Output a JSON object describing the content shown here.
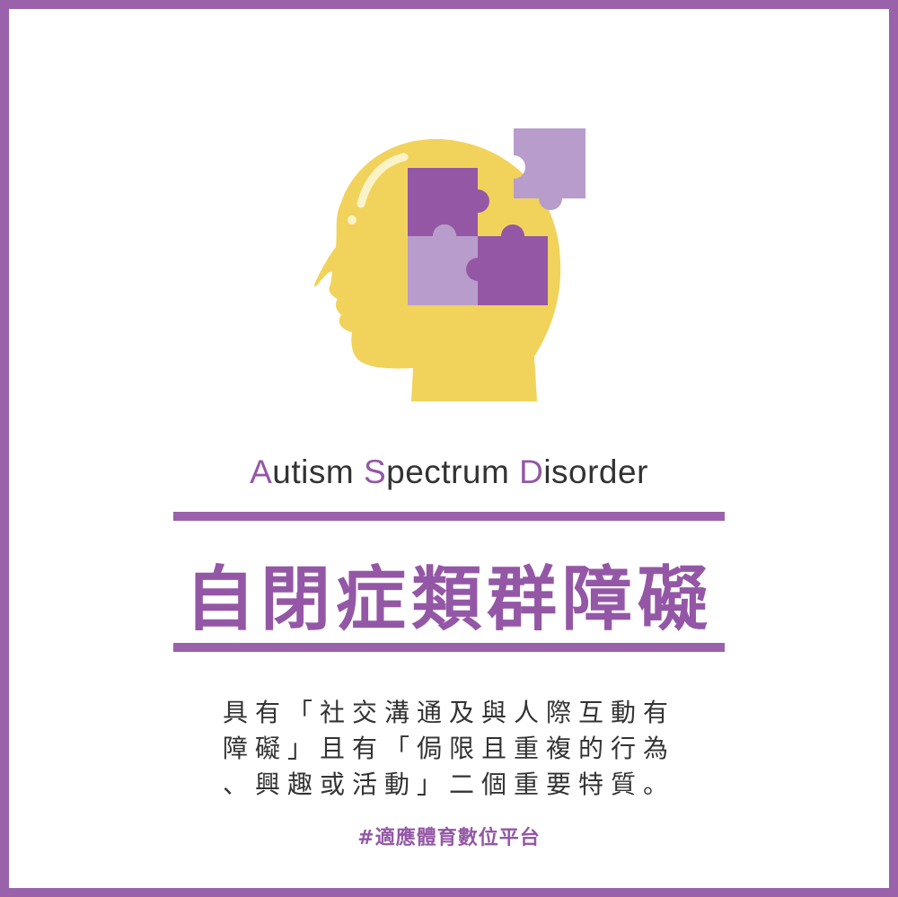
{
  "colors": {
    "frame": "#9a62aa",
    "accent_purple": "#9457a6",
    "light_purple": "#b89ccb",
    "head_yellow": "#f1d35c",
    "text": "#333333"
  },
  "illustration": {
    "icon": "head-with-puzzle-pieces-icon"
  },
  "title_en": {
    "word1_initial": "A",
    "word1_rest": "utism",
    "word2_initial": "S",
    "word2_rest": "pectrum",
    "word3_initial": "D",
    "word3_rest": "isorder"
  },
  "title_zh": "自閉症類群障礙",
  "description": {
    "line1": "具有「社交溝通及與人際互動有",
    "line2": "障礙」且有「侷限且重複的行為",
    "line3": "、興趣或活動」二個重要特質。"
  },
  "hashtag": "#適應體育數位平台"
}
